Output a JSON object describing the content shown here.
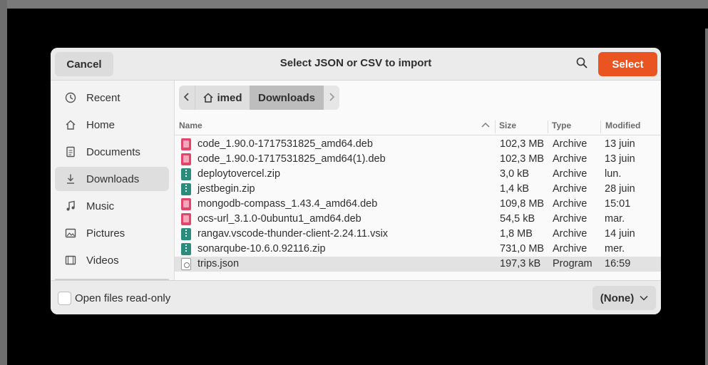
{
  "colors": {
    "accent": "#e95420",
    "header_bg": "#ebebeb",
    "sidebar_active": "#dedede",
    "row_selected": "#e2e2e2"
  },
  "dialog": {
    "title": "Select JSON or CSV to import",
    "cancel_label": "Cancel",
    "select_label": "Select",
    "search_icon": "search-icon"
  },
  "sidebar": {
    "items": [
      {
        "label": "Recent",
        "icon": "clock-icon"
      },
      {
        "label": "Home",
        "icon": "home-icon"
      },
      {
        "label": "Documents",
        "icon": "document-icon"
      },
      {
        "label": "Downloads",
        "icon": "download-icon",
        "active": true
      },
      {
        "label": "Music",
        "icon": "music-icon"
      },
      {
        "label": "Pictures",
        "icon": "picture-icon"
      },
      {
        "label": "Videos",
        "icon": "video-icon"
      }
    ]
  },
  "pathbar": {
    "home_label": "imed",
    "current_label": "Downloads"
  },
  "columns": {
    "name": "Name",
    "size": "Size",
    "type": "Type",
    "modified": "Modified"
  },
  "files": [
    {
      "name": "code_1.90.0-1717531825_amd64.deb",
      "size": "102,3 MB",
      "type": "Archive",
      "modified": "13 juin",
      "icon": "deb"
    },
    {
      "name": "code_1.90.0-1717531825_amd64(1).deb",
      "size": "102,3 MB",
      "type": "Archive",
      "modified": "13 juin",
      "icon": "deb"
    },
    {
      "name": "deploytovercel.zip",
      "size": "3,0 kB",
      "type": "Archive",
      "modified": "lun.",
      "icon": "zip"
    },
    {
      "name": "jestbegin.zip",
      "size": "1,4 kB",
      "type": "Archive",
      "modified": "28 juin",
      "icon": "zip"
    },
    {
      "name": "mongodb-compass_1.43.4_amd64.deb",
      "size": "109,8 MB",
      "type": "Archive",
      "modified": "15:01",
      "icon": "deb"
    },
    {
      "name": "ocs-url_3.1.0-0ubuntu1_amd64.deb",
      "size": "54,5 kB",
      "type": "Archive",
      "modified": "mar.",
      "icon": "deb"
    },
    {
      "name": "rangav.vscode-thunder-client-2.24.11.vsix",
      "size": "1,8 MB",
      "type": "Archive",
      "modified": "14 juin",
      "icon": "zip"
    },
    {
      "name": "sonarqube-10.6.0.92116.zip",
      "size": "731,0 MB",
      "type": "Archive",
      "modified": "mer.",
      "icon": "zip"
    },
    {
      "name": "trips.json",
      "size": "197,3 kB",
      "type": "Program",
      "modified": "16:59",
      "icon": "json",
      "selected": true
    }
  ],
  "footer": {
    "readonly_label": "Open files read-only",
    "readonly_checked": false,
    "filter_value": "(None)"
  }
}
